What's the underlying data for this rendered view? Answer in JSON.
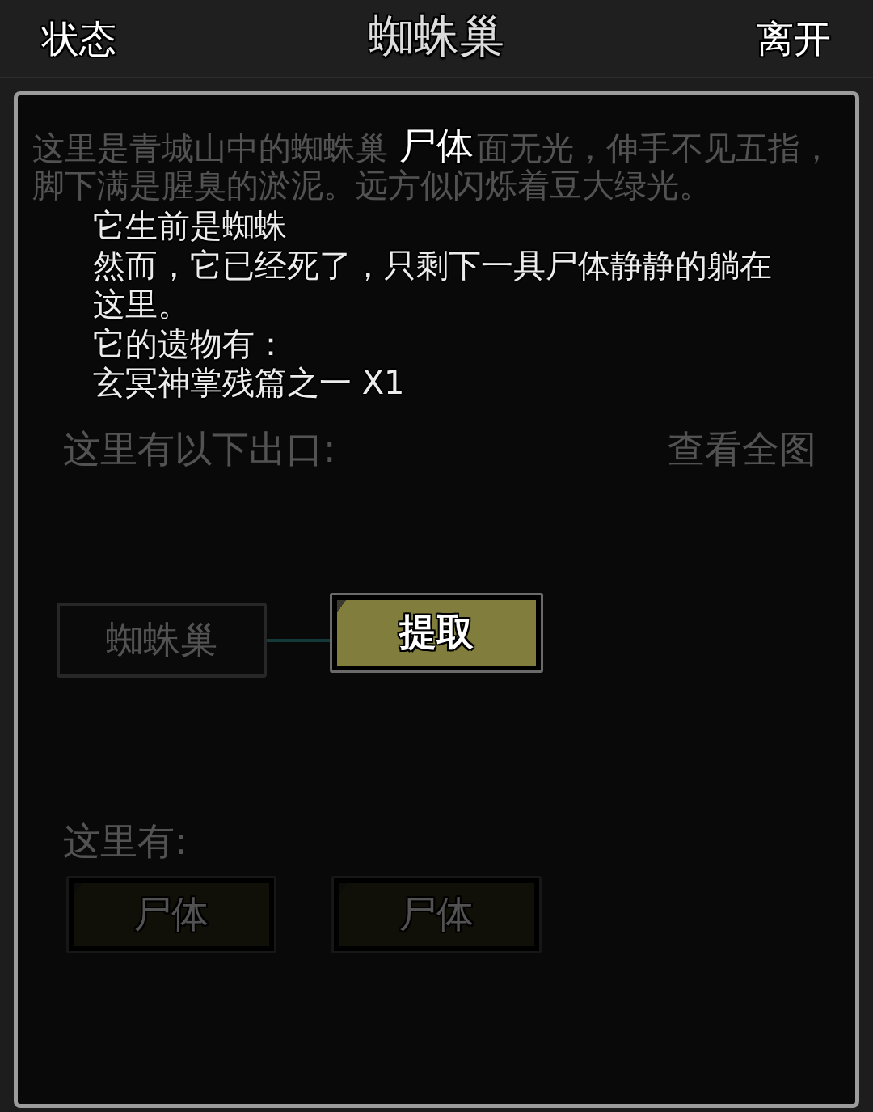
{
  "top_bar": {
    "left_button": "状态",
    "title": "蜘蛛巢",
    "right_button": "离开"
  },
  "location": {
    "description_lines": [
      {
        "parts": [
          "这里是青城山中的蜘蛛巢",
          "面无光，伸手不见五指，"
        ]
      },
      {
        "parts": [
          "脚下满是腥臭的淤泥。远方似闪烁着豆大绿光。"
        ]
      }
    ],
    "exits_label": "这里有以下出口:",
    "map_button": "查看全图",
    "map_nodes": [
      {
        "label": "蜘蛛巢"
      }
    ],
    "here_label": "这里有:",
    "objects": [
      {
        "label": "尸体"
      },
      {
        "label": "尸体"
      }
    ]
  },
  "dialog": {
    "title": "尸体",
    "lines": [
      "它生前是蜘蛛",
      "然而，它已经死了，只剩下一具尸体静静的躺在这里。",
      "它的遗物有：",
      "玄冥神掌残篇之一 X1"
    ],
    "button": "提取"
  }
}
